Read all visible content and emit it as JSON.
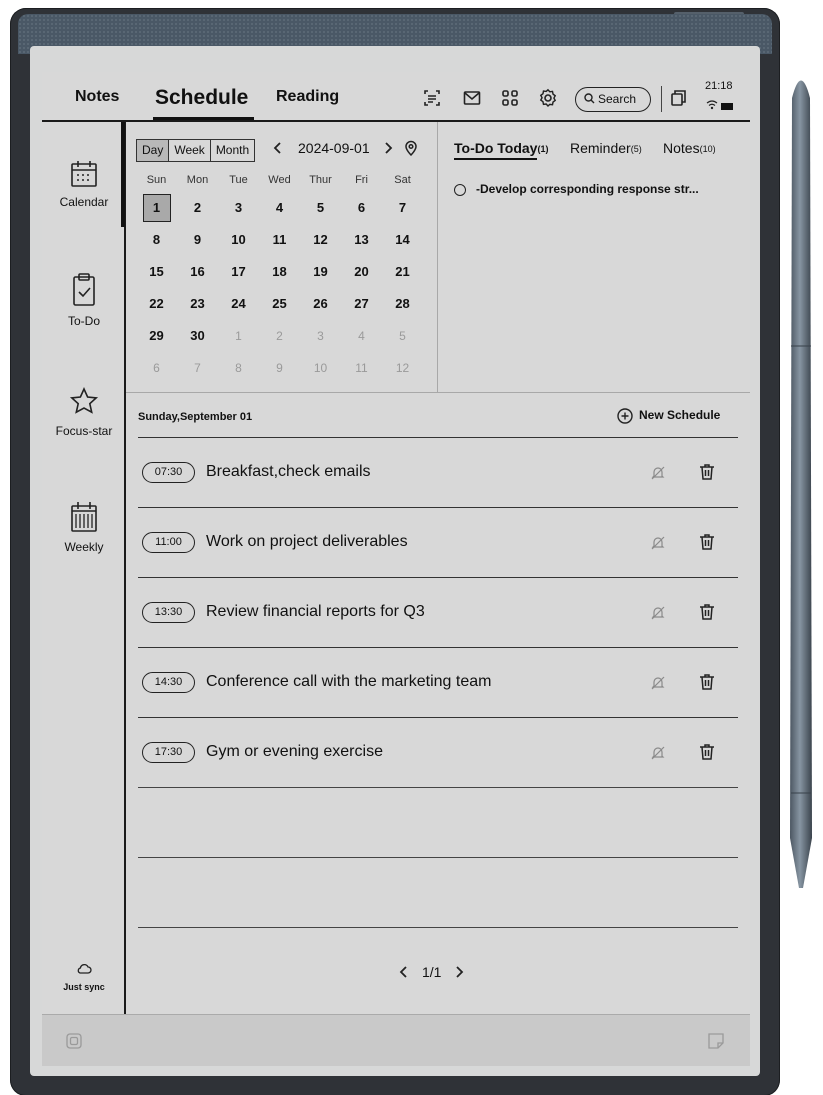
{
  "topbar": {
    "tabs": [
      "Notes",
      "Schedule",
      "Reading"
    ],
    "search_label": "Search",
    "time": "21:18"
  },
  "sidebar": {
    "items": [
      {
        "label": "Calendar",
        "icon": "calendar-icon"
      },
      {
        "label": "To-Do",
        "icon": "todo-clipboard-icon"
      },
      {
        "label": "Focus-star",
        "icon": "star-icon"
      },
      {
        "label": "Weekly",
        "icon": "weekly-calendar-icon"
      }
    ],
    "sync_label": "Just sync"
  },
  "calendar": {
    "views": [
      "Day",
      "Week",
      "Month"
    ],
    "selected_view": "Day",
    "current_date": "2024-09-01",
    "weekdays": [
      "Sun",
      "Mon",
      "Tue",
      "Wed",
      "Thur",
      "Fri",
      "Sat"
    ],
    "days": [
      [
        "1",
        "2",
        "3",
        "4",
        "5",
        "6",
        "7"
      ],
      [
        "8",
        "9",
        "10",
        "11",
        "12",
        "13",
        "14"
      ],
      [
        "15",
        "16",
        "17",
        "18",
        "19",
        "20",
        "21"
      ],
      [
        "22",
        "23",
        "24",
        "25",
        "26",
        "27",
        "28"
      ],
      [
        "29",
        "30",
        "1",
        "2",
        "3",
        "4",
        "5"
      ],
      [
        "6",
        "7",
        "8",
        "9",
        "10",
        "11",
        "12"
      ]
    ]
  },
  "panel": {
    "tabs": [
      {
        "label": "To-Do Today",
        "count": "(1)"
      },
      {
        "label": "Reminder",
        "count": "(5)"
      },
      {
        "label": "Notes",
        "count": "(10)"
      }
    ],
    "todo_item": "-Develop corresponding response str..."
  },
  "schedule": {
    "day_label": "Sunday,September 01",
    "new_label": "New Schedule",
    "items": [
      {
        "time": "07:30",
        "text": "Breakfast,check emails"
      },
      {
        "time": "11:00",
        "text": "Work on project deliverables"
      },
      {
        "time": "13:30",
        "text": "Review financial reports for Q3"
      },
      {
        "time": "14:30",
        "text": "Conference call with the marketing team"
      },
      {
        "time": "17:30",
        "text": "Gym or evening exercise"
      }
    ],
    "page": "1/1"
  }
}
